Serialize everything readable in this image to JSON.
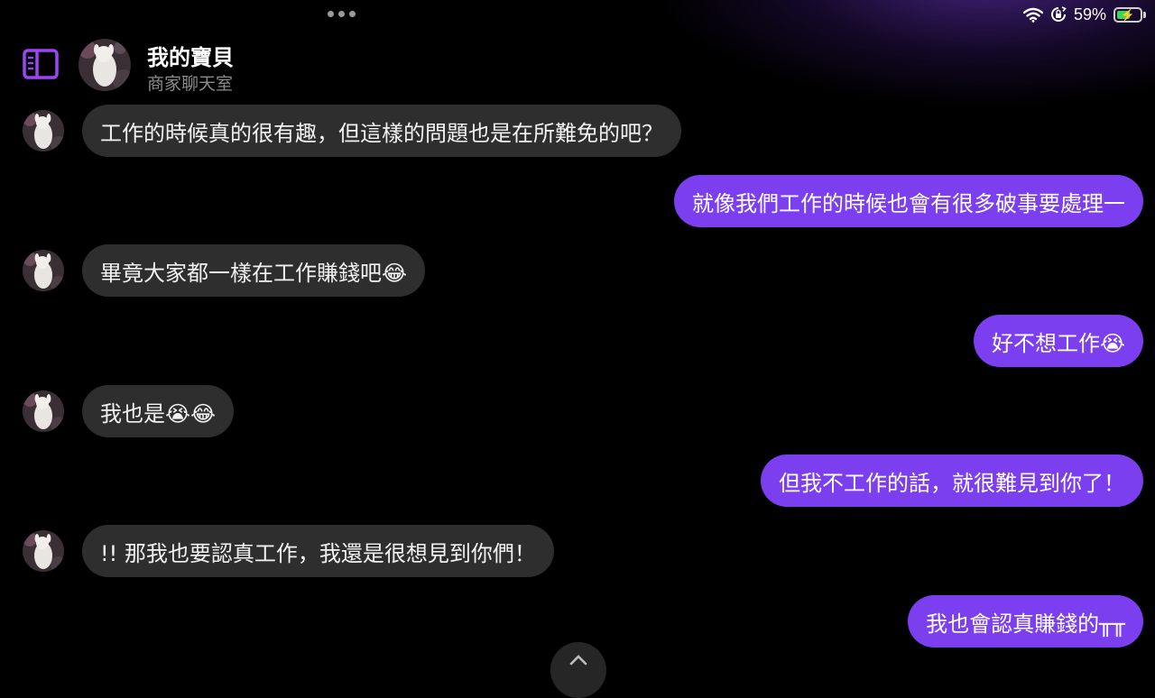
{
  "status_bar": {
    "battery_percent": "59%",
    "battery_level": 0.59,
    "charging": true,
    "icons": [
      "wifi-icon",
      "rotation-lock-icon",
      "battery-charging-icon"
    ]
  },
  "header": {
    "title": "我的寶貝",
    "subtitle": "商家聊天室",
    "icons": [
      "sidebar-toggle-icon",
      "avatar"
    ]
  },
  "colors": {
    "background": "#000000",
    "incoming_bubble": "#2e2e2e",
    "outgoing_bubble": "#7b3ff0",
    "accent": "#9b45f5",
    "subtitle": "#8c8c8c"
  },
  "messages": [
    {
      "side": "incoming",
      "text": "工作的時候真的很有趣，但這樣的問題也是在所難免的吧？"
    },
    {
      "side": "outgoing",
      "text": "就像我們工作的時候也會有很多破事要處理一"
    },
    {
      "side": "incoming",
      "text": "畢竟大家都一樣在工作賺錢吧😂"
    },
    {
      "side": "outgoing",
      "text": "好不想工作😭"
    },
    {
      "side": "incoming",
      "text": "我也是😭😂"
    },
    {
      "side": "outgoing",
      "text": "但我不工作的話，就很難見到你了！"
    },
    {
      "side": "incoming",
      "text": "!! 那我也要認真工作，我還是很想見到你們！"
    },
    {
      "side": "outgoing",
      "text": "我也會認真賺錢的╥╥"
    }
  ],
  "scroll_button": {
    "icon": "chevron-up-icon"
  }
}
